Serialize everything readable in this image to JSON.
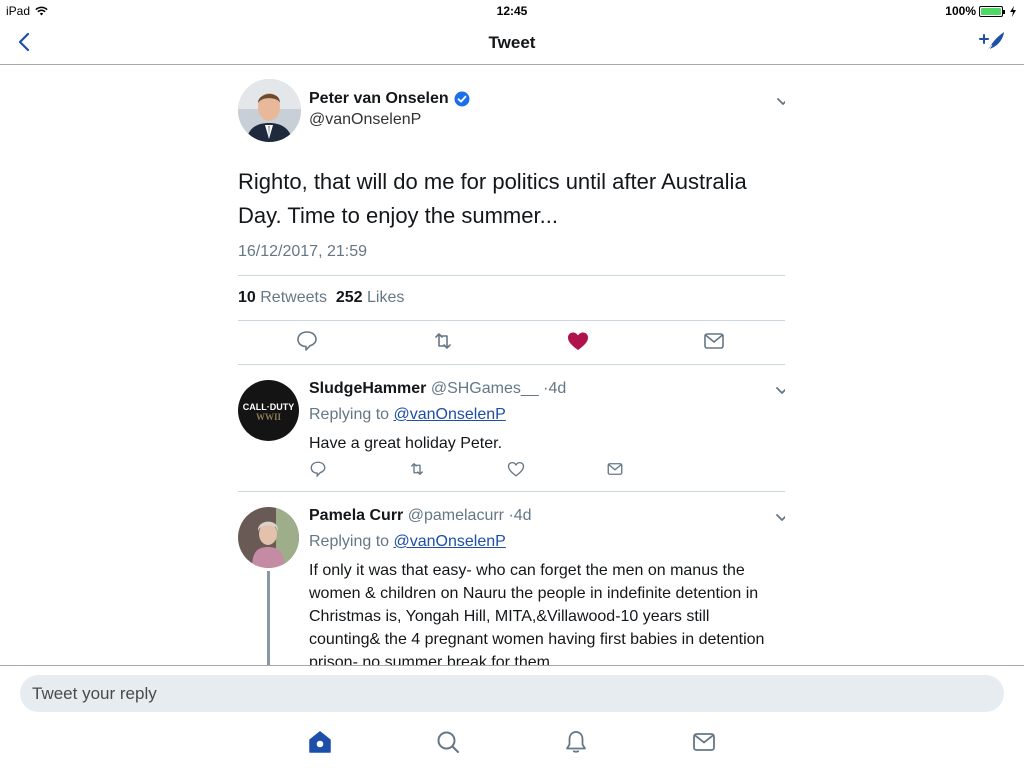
{
  "status": {
    "device": "iPad",
    "time": "12:45",
    "battery": "100%",
    "battery_level": 1.0
  },
  "nav": {
    "title": "Tweet",
    "back_icon": "back-chevron-icon",
    "compose_icon": "compose-tweet-icon"
  },
  "tweet": {
    "author_name": "Peter van Onselen",
    "author_handle": "@vanOnselenP",
    "text": "Righto, that will do me for politics until after Australia Day. Time to enjoy the summer...",
    "timestamp": "16/12/2017, 21:59",
    "retweets_count": "10",
    "retweets_label": "Retweets",
    "likes_count": "252",
    "likes_label": "Likes",
    "liked": true,
    "like_color": "#b0124b",
    "verified_color": "#1d6fe8"
  },
  "replies": [
    {
      "name": "SludgeHammer",
      "handle": "@SHGames__",
      "age": "·4d",
      "replying_prefix": "Replying to",
      "replying_to": "@vanOnselenP",
      "text": "Have a great holiday Peter.",
      "avatar_text_1": "CALL·DUTY",
      "avatar_text_2": "WWII"
    },
    {
      "name": "Pamela Curr",
      "handle": "@pamelacurr",
      "age": "·4d",
      "replying_prefix": "Replying to",
      "replying_to": "@vanOnselenP",
      "text": "If only it was that easy- who can forget the men on manus the women & children on Nauru the people in indefinite detention in Christmas is, Yongah Hill, MITA,&Villawood-10 years still counting& the 4 pregnant women having first babies in detention prison- no summer break for them"
    }
  ],
  "compose": {
    "placeholder": "Tweet your reply"
  },
  "tabs": [
    "home-icon",
    "search-icon",
    "notifications-icon",
    "messages-icon"
  ],
  "colors": {
    "brand_blue": "#1d4ea8",
    "muted": "#657786",
    "active_tab": "#1d4ea8"
  }
}
